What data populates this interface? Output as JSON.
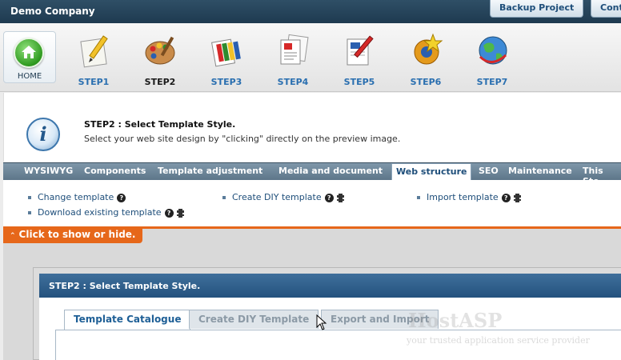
{
  "app": {
    "company": "Demo Company"
  },
  "top_tabs": [
    {
      "label": "Backup Project"
    },
    {
      "label": "Cont"
    }
  ],
  "home": {
    "label": "HOME"
  },
  "steps": [
    {
      "label": "STEP1",
      "icon": "pencil-paper-icon"
    },
    {
      "label": "STEP2",
      "icon": "paint-palette-icon",
      "active": true
    },
    {
      "label": "STEP3",
      "icon": "color-swatches-icon"
    },
    {
      "label": "STEP4",
      "icon": "documents-icon"
    },
    {
      "label": "STEP5",
      "icon": "edit-document-icon"
    },
    {
      "label": "STEP6",
      "icon": "gear-star-icon"
    },
    {
      "label": "STEP7",
      "icon": "publish-globe-icon"
    }
  ],
  "info": {
    "title": "STEP2 : Select Template Style.",
    "description": "Select your web site design by \"clicking\" directly on the preview image."
  },
  "menu": [
    {
      "label": "WYSIWYG"
    },
    {
      "label": "Components"
    },
    {
      "label": "Template adjustment"
    },
    {
      "label": "Media and document"
    },
    {
      "label": "Web structure",
      "active": true
    },
    {
      "label": "SEO"
    },
    {
      "label": "Maintenance"
    },
    {
      "label": "This Ste"
    }
  ],
  "links": [
    {
      "label": "Change template",
      "help": "?"
    },
    {
      "label": "Create DIY template",
      "help": "?"
    },
    {
      "label": "Import template",
      "help": "?"
    },
    {
      "label": "Download existing template",
      "help": "?"
    }
  ],
  "toggle": {
    "label": "Click to show or hide."
  },
  "dialog": {
    "title": "STEP2 : Select Template Style.",
    "tabs": [
      {
        "label": "Template Catalogue",
        "active": true
      },
      {
        "label": "Create DIY Template"
      },
      {
        "label": "Export and Import"
      }
    ]
  },
  "watermark": {
    "brand": "HostASP",
    "tagline": "your trusted application service provider"
  }
}
